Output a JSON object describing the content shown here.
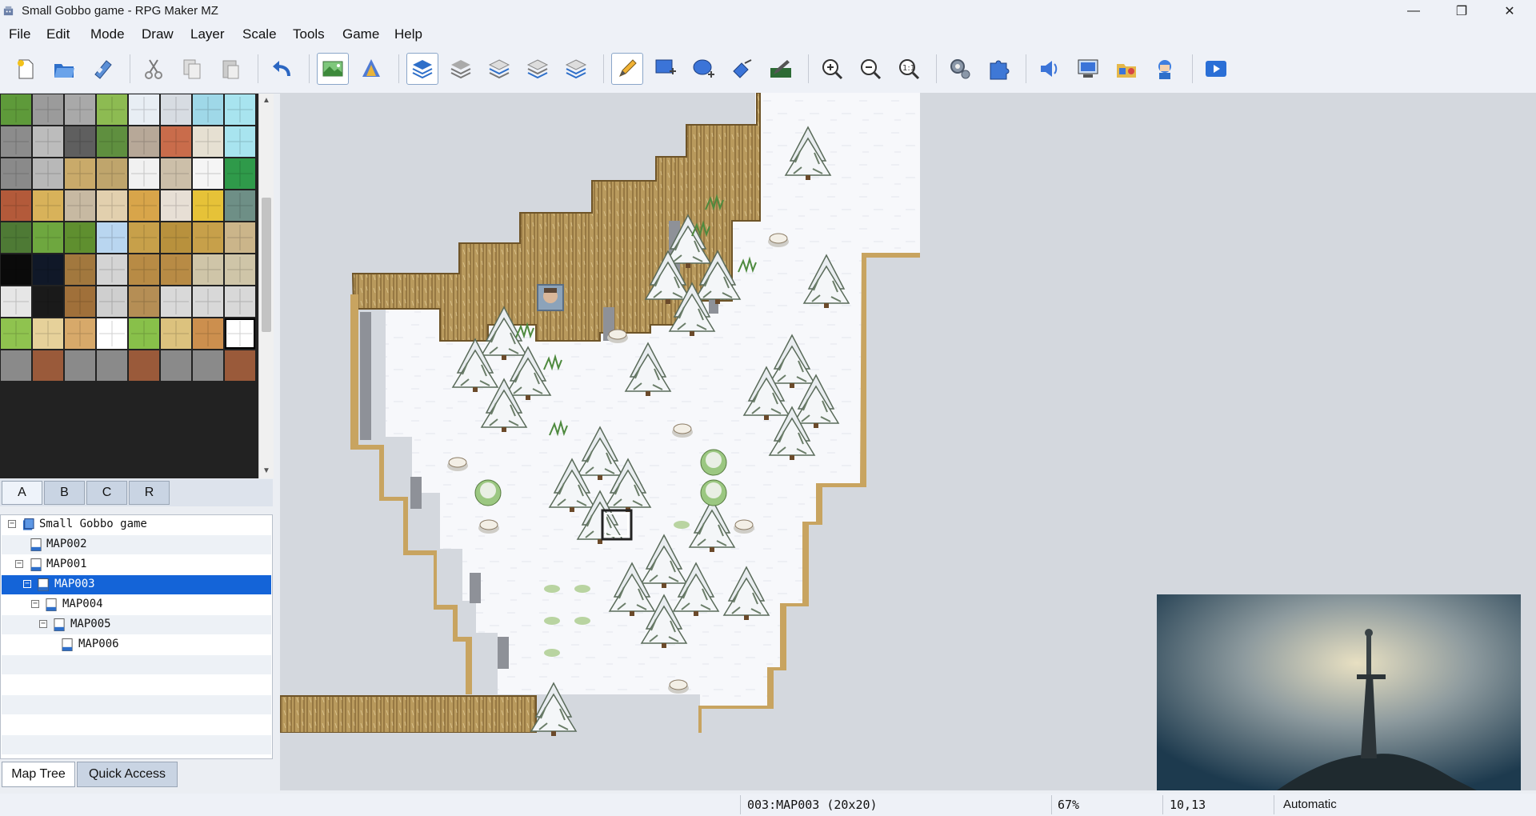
{
  "window": {
    "title": "Small Gobbo game - RPG Maker MZ",
    "minimize": "—",
    "restore": "❐",
    "close": "✕"
  },
  "menu": [
    "File",
    "Edit",
    "Mode",
    "Draw",
    "Layer",
    "Scale",
    "Tools",
    "Game",
    "Help"
  ],
  "toolbar_icons": [
    "new-project",
    "open-project",
    "save-project",
    "cut",
    "copy",
    "paste",
    "undo",
    "map-mode",
    "event-mode",
    "layer-auto",
    "layer-1",
    "layer-2",
    "layer-3",
    "layer-4",
    "pencil",
    "rectangle",
    "ellipse",
    "flood-fill",
    "shadow-pen",
    "zoom-in",
    "zoom-out",
    "actual-size",
    "database",
    "plugin-manager",
    "sound-test",
    "event-searcher",
    "resource-manager",
    "character-generator",
    "playtest"
  ],
  "tileset_tabs": [
    "A",
    "B",
    "C",
    "R"
  ],
  "tileset_selected_tab": "A",
  "map_tree": {
    "items": [
      {
        "label": "Small Gobbo game",
        "level": 0,
        "expander": "−",
        "type": "project"
      },
      {
        "label": "MAP002",
        "level": 1,
        "expander": "",
        "type": "map"
      },
      {
        "label": "MAP001",
        "level": 1,
        "expander": "−",
        "type": "map"
      },
      {
        "label": "MAP003",
        "level": 2,
        "expander": "−",
        "type": "map",
        "selected": true
      },
      {
        "label": "MAP004",
        "level": 3,
        "expander": "−",
        "type": "map"
      },
      {
        "label": "MAP005",
        "level": 4,
        "expander": "−",
        "type": "map"
      },
      {
        "label": "MAP006",
        "level": 5,
        "expander": "",
        "type": "map"
      }
    ]
  },
  "bottom_tabs": {
    "map_tree": "Map Tree",
    "quick_access": "Quick Access"
  },
  "status": {
    "map": "003:MAP003 (20x20)",
    "zoom": "67%",
    "coords": "10,13",
    "mode": "Automatic"
  },
  "colors": {
    "accent": "#1464d8",
    "snow": "#ffffff",
    "cliff": "#b89a5c",
    "void": "#d4d8de"
  }
}
